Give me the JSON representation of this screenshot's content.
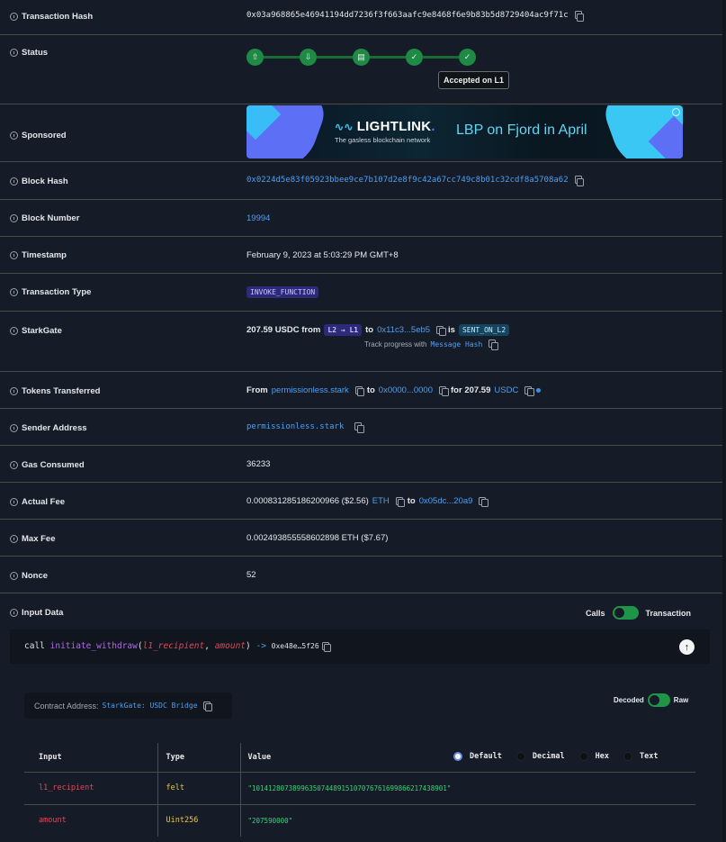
{
  "rows": {
    "tx_hash": {
      "label": "Transaction Hash",
      "value": "0x03a968865e46941194dd7236f3f663aafc9e8468f6e9b83b5d8729404ac9f71c"
    },
    "status": {
      "label": "Status",
      "steps": [
        "submitted",
        "received",
        "prepared",
        "accepted-on-l2",
        "accepted-on-l1"
      ],
      "tooltip": "Accepted on L1"
    },
    "sponsored": {
      "label": "Sponsored",
      "brand": "LIGHTLINK",
      "brand_dot": ".",
      "tagline": "The gasless blockchain network",
      "headline": "LBP on Fjord in April"
    },
    "block_hash": {
      "label": "Block Hash",
      "value": "0x0224d5e83f05923bbee9ce7b107d2e8f9c42a67cc749c8b01c32cdf8a5708a62"
    },
    "block_number": {
      "label": "Block Number",
      "value": "19994"
    },
    "timestamp": {
      "label": "Timestamp",
      "value": "February 9, 2023 at 5:03:29 PM GMT+8"
    },
    "tx_type": {
      "label": "Transaction Type",
      "value": "INVOKE_FUNCTION"
    },
    "starkgate": {
      "label": "StarkGate",
      "amount": "207.59 USDC from",
      "direction": "L2 → L1",
      "to_word": "to",
      "to_address": "0x11c3...5eb5",
      "is_word": "is",
      "status": "SENT_ON_L2",
      "track_text": "Track progress with",
      "track_link": "Message Hash"
    },
    "tokens_transferred": {
      "label": "Tokens Transferred",
      "from_word": "From",
      "from": "permissionless.stark",
      "to_word": "to",
      "to": "0x0000...0000",
      "for_word": "for 207.59",
      "token": "USDC"
    },
    "sender": {
      "label": "Sender Address",
      "value": "permissionless.stark"
    },
    "gas": {
      "label": "Gas Consumed",
      "value": "36233"
    },
    "actual_fee": {
      "label": "Actual Fee",
      "amount": "0.000831285186200966 ($2.56)",
      "token": "ETH",
      "to_word": "to",
      "to": "0x05dc...20a9"
    },
    "max_fee": {
      "label": "Max Fee",
      "value": "0.002493855558602898 ETH ($7.67)"
    },
    "nonce": {
      "label": "Nonce",
      "value": "52"
    },
    "input_data": {
      "label": "Input Data",
      "toggle_left": "Calls",
      "toggle_right": "Transaction"
    }
  },
  "call": {
    "keyword": "call",
    "function": "initiate_withdraw",
    "open_paren": "(",
    "param1": "l1_recipient",
    "comma": ", ",
    "param2": "amount",
    "close_paren": ")",
    "arrow": "->",
    "target": "0xe48e…5f26"
  },
  "contract": {
    "label": "Contract Address:",
    "value": "StarkGate: USDC Bridge"
  },
  "decode_toggle": {
    "left": "Decoded",
    "right": "Raw"
  },
  "table": {
    "headers": [
      "Input",
      "Type",
      "Value"
    ],
    "radios": [
      {
        "label": "Default",
        "selected": true
      },
      {
        "label": "Decimal",
        "selected": false
      },
      {
        "label": "Hex",
        "selected": false
      },
      {
        "label": "Text",
        "selected": false
      }
    ],
    "rows": [
      {
        "input": "l1_recipient",
        "type": "felt",
        "value": "\"101412807389963507448915107076761699866217438901\""
      },
      {
        "input": "amount",
        "type": "Uint256",
        "value": "\"207590000\""
      }
    ]
  },
  "colors": {
    "background": "#161c27",
    "link": "#4f9ff0",
    "success": "#1f8a45",
    "param": "#e0485a",
    "function": "#b06be8",
    "type": "#e8c547",
    "value": "#3dd07a"
  }
}
